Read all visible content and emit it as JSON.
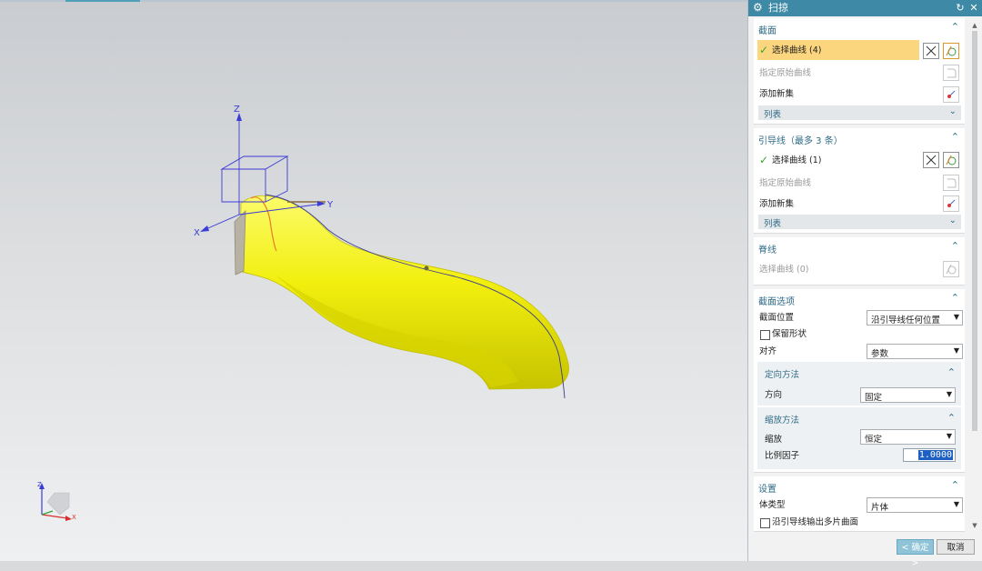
{
  "dialog": {
    "title": "扫掠",
    "sections": {
      "section_curves": {
        "title": "截面",
        "select_curve": "选择曲线 (4)",
        "specify_origin": "指定原始曲线",
        "add_new_set": "添加新集",
        "list": "列表"
      },
      "guide_curves": {
        "title": "引导线（最多 3 条）",
        "select_curve": "选择曲线 (1)",
        "specify_origin": "指定原始曲线",
        "add_new_set": "添加新集",
        "list": "列表"
      },
      "spine": {
        "title": "脊线",
        "select_curve": "选择曲线 (0)"
      },
      "section_options": {
        "title": "截面选项",
        "section_location_label": "截面位置",
        "section_location_value": "沿引导线任何位置",
        "preserve_shape": "保留形状",
        "alignment_label": "对齐",
        "alignment_value": "参数",
        "orientation": {
          "title": "定向方法",
          "direction_label": "方向",
          "direction_value": "固定"
        },
        "scaling": {
          "title": "缩放方法",
          "scaling_label": "缩放",
          "scaling_value": "恒定",
          "scale_factor_label": "比例因子",
          "scale_factor_value": "1.0000"
        }
      },
      "settings": {
        "title": "设置",
        "body_type_label": "体类型",
        "body_type_value": "片体",
        "multi_output": "沿引导线输出多片曲面"
      }
    },
    "buttons": {
      "ok": "< 确定 >",
      "cancel": "取消"
    }
  },
  "viewport": {
    "csys_labels": {
      "z": "Z",
      "y": "Y",
      "x": "X"
    },
    "triad_labels": {
      "z": "Z",
      "x": "X"
    },
    "colors": {
      "body": "#f2ef0e",
      "csys": "#3b3bd6",
      "highlight": "#fcd67e",
      "accent": "#3e8aa6"
    }
  }
}
